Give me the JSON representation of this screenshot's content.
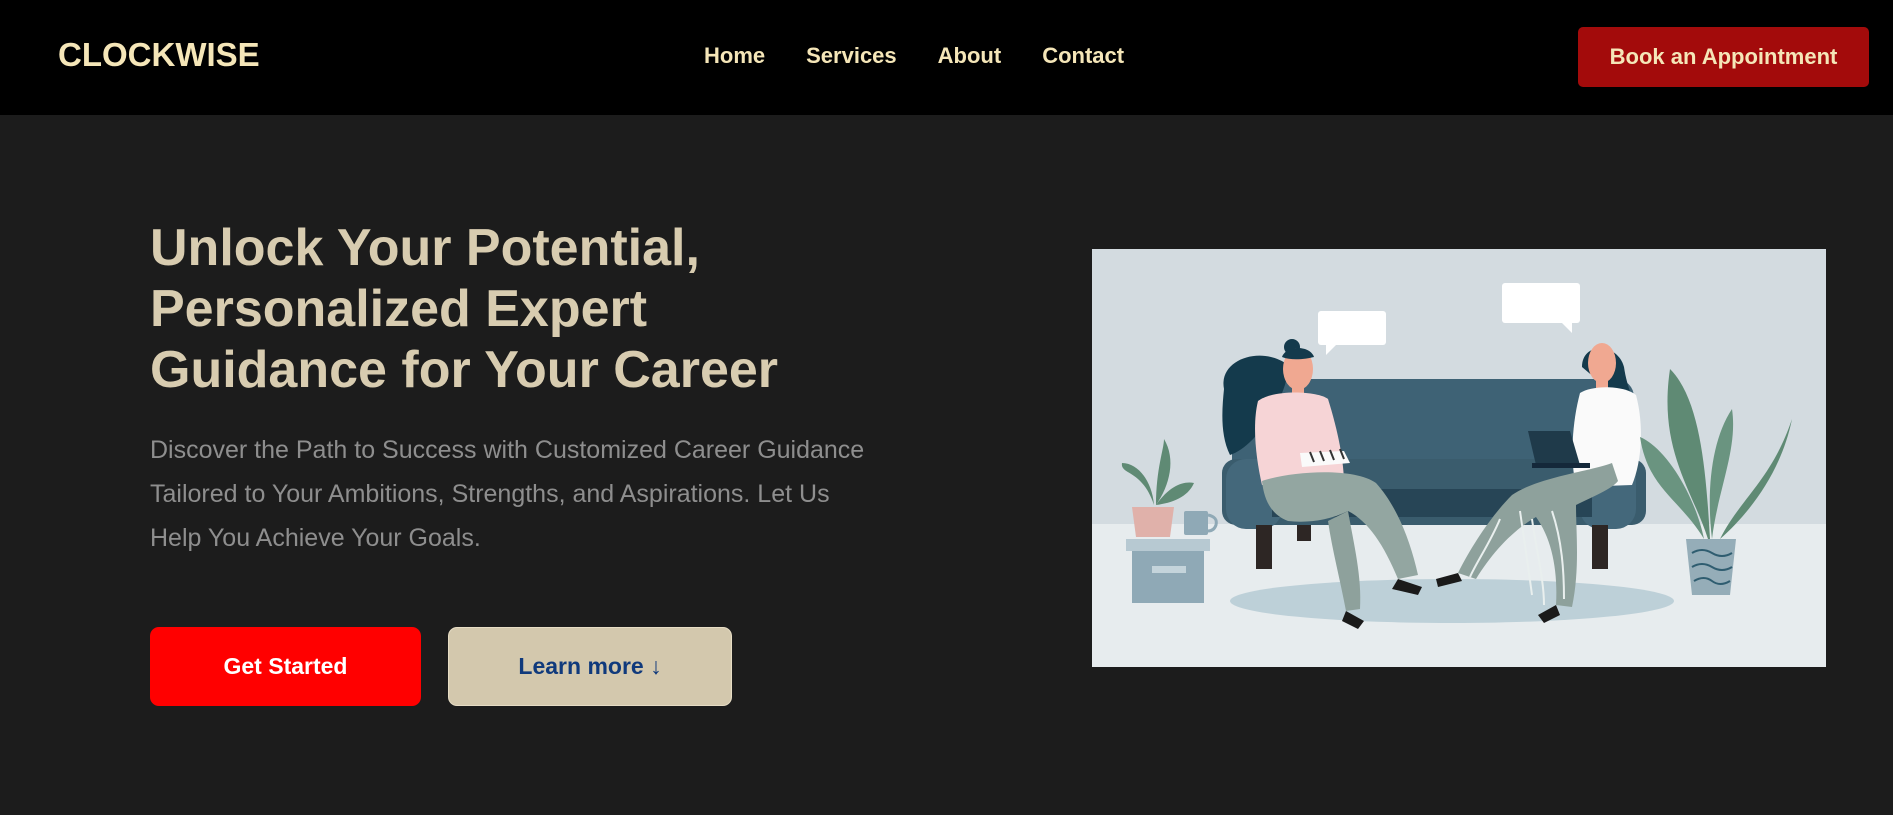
{
  "navbar": {
    "logo": "CLOCKWISE",
    "links": [
      "Home",
      "Services",
      "About",
      "Contact"
    ],
    "cta_label": "Book an Appointment"
  },
  "hero": {
    "title": "Unlock Your Potential, Personalized Expert Guidance for Your Career",
    "subtitle": "Discover the Path to Success with Customized Career Guidance Tailored to Your Ambitions, Strengths, and Aspirations. Let Us Help You Achieve Your Goals.",
    "primary_button": "Get Started",
    "secondary_button": "Learn more ↓"
  },
  "colors": {
    "accent_red": "#ff0000",
    "cta_dark_red": "#a30b0b",
    "cream": "#f5e6b8",
    "beige": "#d3c8ad",
    "link_blue": "#103a7c",
    "background": "#1c1c1c"
  }
}
